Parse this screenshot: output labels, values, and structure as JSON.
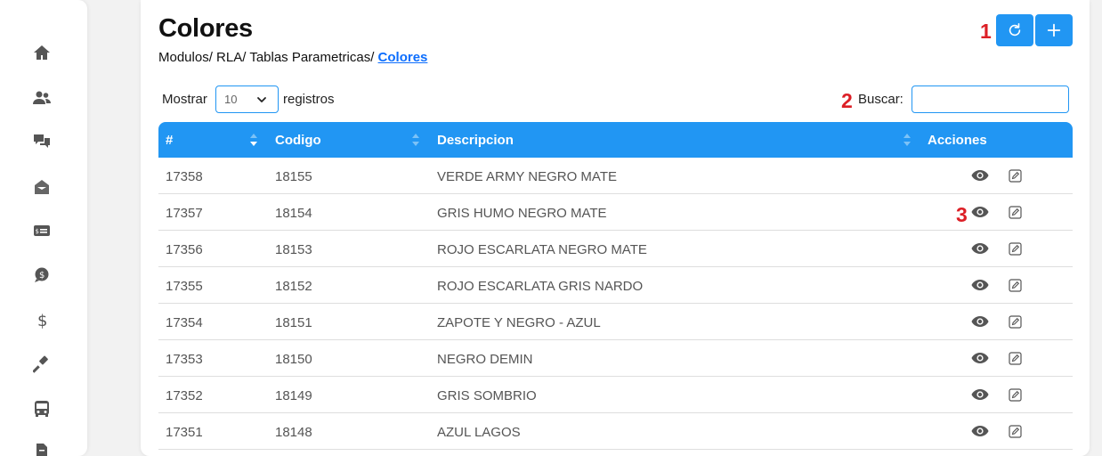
{
  "sidebar": {
    "icons": [
      "home-icon",
      "users-icon",
      "chat-icon",
      "inbox-icon",
      "money-card-icon",
      "coin-chat-icon",
      "dollar-icon",
      "gavel-icon",
      "bus-icon",
      "document-icon"
    ]
  },
  "header": {
    "title": "Colores",
    "breadcrumb": [
      "Modulos/",
      "RLA/",
      "Tablas Parametricas/"
    ],
    "breadcrumb_current": "Colores"
  },
  "markers": [
    "1",
    "2",
    "3"
  ],
  "toolbar": {
    "refresh_icon": "refresh-icon",
    "add_icon": "plus-icon"
  },
  "table_controls": {
    "show_label": "Mostrar",
    "page_size": "10",
    "records_label": "registros",
    "search_label": "Buscar:",
    "search_value": ""
  },
  "table": {
    "headers": [
      "#",
      "Codigo",
      "Descripcion",
      "Acciones"
    ],
    "rows": [
      {
        "id": "17358",
        "code": "18155",
        "desc": "VERDE ARMY NEGRO MATE"
      },
      {
        "id": "17357",
        "code": "18154",
        "desc": "GRIS HUMO NEGRO MATE"
      },
      {
        "id": "17356",
        "code": "18153",
        "desc": "ROJO ESCARLATA NEGRO MATE"
      },
      {
        "id": "17355",
        "code": "18152",
        "desc": "ROJO ESCARLATA GRIS NARDO"
      },
      {
        "id": "17354",
        "code": "18151",
        "desc": "ZAPOTE Y NEGRO - AZUL"
      },
      {
        "id": "17353",
        "code": "18150",
        "desc": "NEGRO DEMIN"
      },
      {
        "id": "17352",
        "code": "18149",
        "desc": "GRIS SOMBRIO"
      },
      {
        "id": "17351",
        "code": "18148",
        "desc": "AZUL LAGOS"
      }
    ]
  },
  "colors": {
    "accent": "#2196f3",
    "marker": "#dc1f26",
    "link": "#0d6efd"
  }
}
